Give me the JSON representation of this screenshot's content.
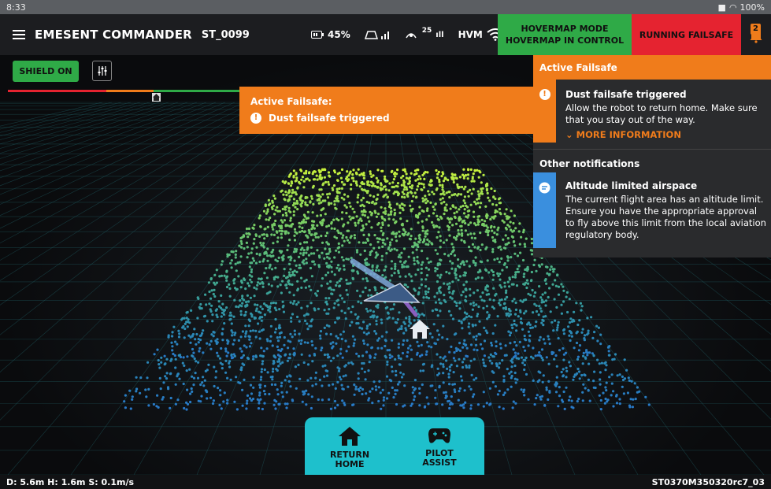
{
  "status_bar": {
    "time": "8:33",
    "battery": "100%"
  },
  "header": {
    "title": "EMESENT COMMANDER",
    "device_id": "ST_0099",
    "battery_level": "45%",
    "satellites": "25",
    "hvm_label": "HVM",
    "mode_line1": "HOVERMAP MODE",
    "mode_line2": "HOVERMAP IN CONTROL",
    "failsafe_label": "RUNNING FAILSAFE",
    "notification_count": "2"
  },
  "controls": {
    "shield_label": "SHIELD ON"
  },
  "toast": {
    "title": "Active Failsafe:",
    "message": "Dust failsafe triggered"
  },
  "panel": {
    "active_header": "Active Failsafe",
    "active_item": {
      "title": "Dust failsafe triggered",
      "body": "Allow the robot to return home. Make sure that you stay out of the way.",
      "more": "MORE INFORMATION"
    },
    "other_header": "Other notifications",
    "other_item": {
      "title": "Altitude limited airspace",
      "body": "The current flight area has an altitude limit. Ensure you have the appropriate approval to fly above this limit from the local aviation regulatory body."
    }
  },
  "dock": {
    "return_home_l1": "RETURN",
    "return_home_l2": "HOME",
    "pilot_assist_l1": "PILOT",
    "pilot_assist_l2": "ASSIST"
  },
  "footer": {
    "telemetry": "D: 5.6m  H: 1.6m  S: 0.1m/s",
    "build": "ST0370M350320rc7_03"
  },
  "colors": {
    "accent_orange": "#f07c1b",
    "mode_green": "#2faa47",
    "failsafe_red": "#e52330",
    "dock_cyan": "#1ec0cc",
    "info_blue": "#3a8fde"
  },
  "icons": [
    "menu-icon",
    "battery-icon",
    "signal-icon",
    "satellite-icon",
    "wifi-icon",
    "bell-icon",
    "sliders-icon",
    "home-icon",
    "alert-icon",
    "chat-icon",
    "gamepad-icon",
    "chevron-down-icon"
  ]
}
